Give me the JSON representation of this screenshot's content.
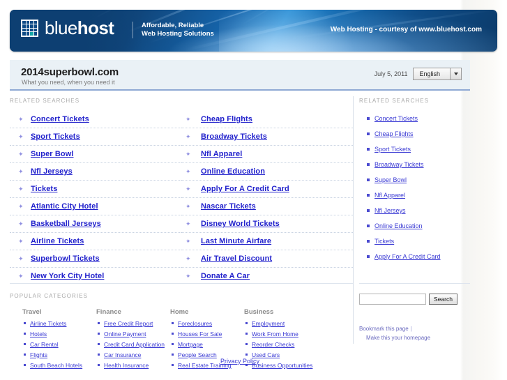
{
  "banner": {
    "brand_light": "blue",
    "brand_bold": "host",
    "tagline_line1": "Affordable, Reliable",
    "tagline_line2": "Web Hosting Solutions",
    "credit": "Web Hosting - courtesy of www.bluehost.com",
    "colors": {
      "dark_blue": "#0d4a85",
      "light_blue": "#2b8fd6",
      "teal": "#16a8a8"
    }
  },
  "titlebar": {
    "domain": "2014superbowl.com",
    "subtitle": "What you need, when you need it",
    "date": "July 5, 2011",
    "language": "English",
    "language_options": [
      "English"
    ]
  },
  "main": {
    "related_label": "RELATED SEARCHES",
    "related_columns": [
      [
        "Concert Tickets",
        "Sport Tickets",
        "Super Bowl",
        "Nfl Jerseys",
        "Tickets",
        "Atlantic City Hotel",
        "Basketball Jerseys",
        "Airline Tickets",
        "Superbowl Tickets",
        "New York City Hotel"
      ],
      [
        "Cheap Flights",
        "Broadway Tickets",
        "Nfl Apparel",
        "Online Education",
        "Apply For A Credit Card",
        "Nascar Tickets",
        "Disney World Tickets",
        "Last Minute Airfare",
        "Air Travel Discount",
        "Donate A Car"
      ]
    ],
    "popular_label": "POPULAR CATEGORIES",
    "categories": [
      {
        "title": "Travel",
        "items": [
          "Airline Tickets",
          "Hotels",
          "Car Rental",
          "Flights",
          "South Beach Hotels"
        ]
      },
      {
        "title": "Finance",
        "items": [
          "Free Credit Report",
          "Online Payment",
          "Credit Card Application",
          "Car Insurance",
          "Health Insurance"
        ]
      },
      {
        "title": "Home",
        "items": [
          "Foreclosures",
          "Houses For Sale",
          "Mortgage",
          "People Search",
          "Real Estate Training"
        ]
      },
      {
        "title": "Business",
        "items": [
          "Employment",
          "Work From Home",
          "Reorder Checks",
          "Used Cars",
          "Business Opportunities"
        ]
      }
    ]
  },
  "sidebar": {
    "related_label": "RELATED SEARCHES",
    "related_items": [
      "Concert Tickets",
      "Cheap Flights",
      "Sport Tickets",
      "Broadway Tickets",
      "Super Bowl",
      "Nfl Apparel",
      "Nfl Jerseys",
      "Online Education",
      "Tickets",
      "Apply For A Credit Card"
    ],
    "search_value": "",
    "search_placeholder": "",
    "search_button": "Search",
    "bookmark_link": "Bookmark this page",
    "homepage_link": "Make this your homepage"
  },
  "footer": {
    "privacy_link": "Privacy Policy"
  }
}
